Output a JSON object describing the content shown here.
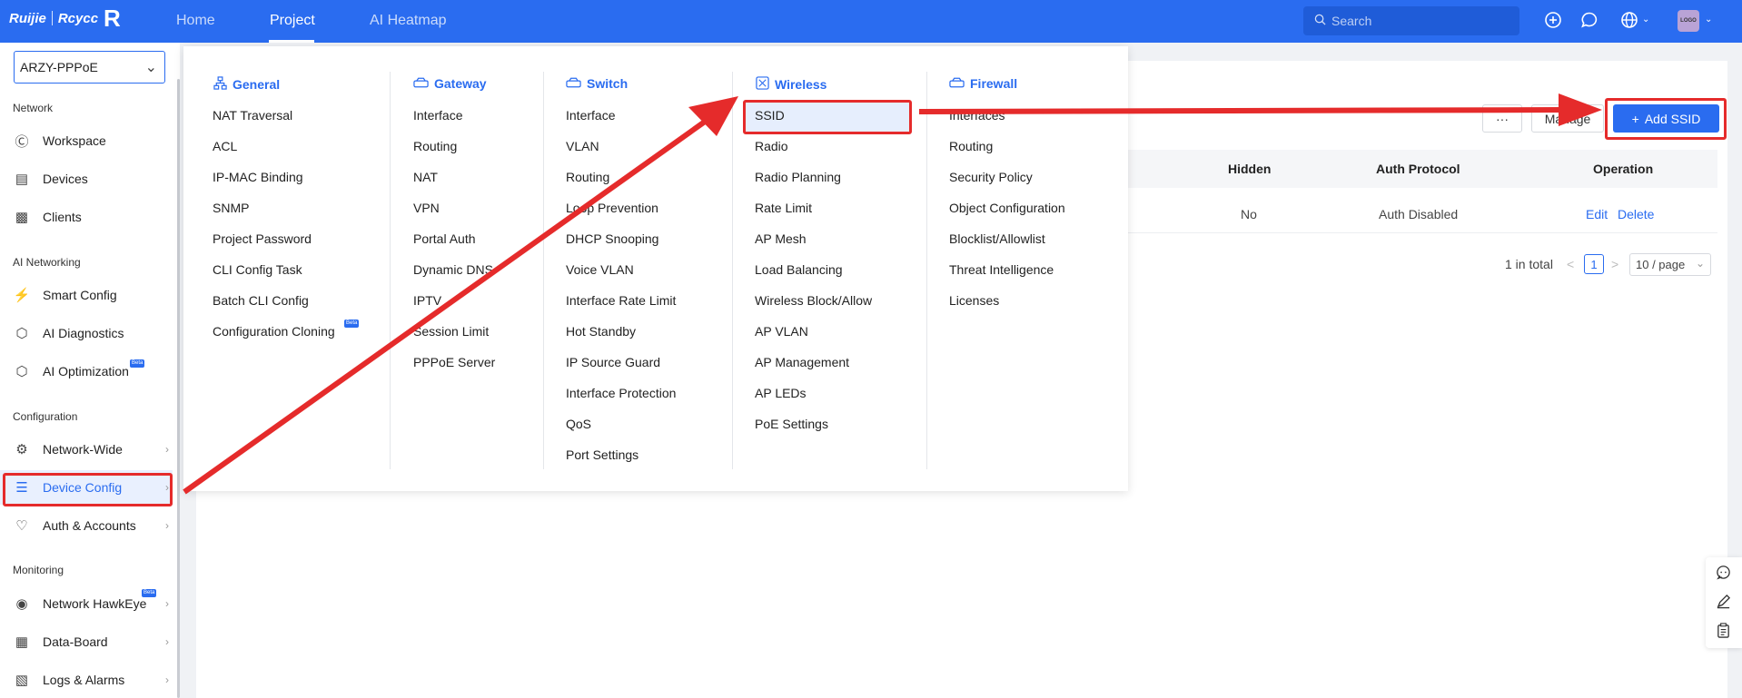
{
  "topbar": {
    "brand": "Ruijie",
    "brand2": "Rcycc",
    "brand_mark": "R",
    "nav": [
      "Home",
      "Project",
      "AI Heatmap"
    ],
    "active_nav": "Project",
    "search_placeholder": "Search",
    "avatar_text": "LOGO",
    "accent": "#2a6cf0"
  },
  "sidebar": {
    "project": "ARZY-PPPoE",
    "sections": {
      "network": "Network",
      "ai": "AI Networking",
      "config": "Configuration",
      "monitoring": "Monitoring"
    },
    "items": {
      "workspace": "Workspace",
      "devices": "Devices",
      "clients": "Clients",
      "smart_config": "Smart Config",
      "ai_diagnostics": "AI Diagnostics",
      "ai_optimization": "AI Optimization",
      "network_wide": "Network-Wide",
      "device_config": "Device Config",
      "auth_accounts": "Auth & Accounts",
      "network_hawkeye": "Network HawkEye",
      "data_board": "Data-Board",
      "logs_alarms": "Logs & Alarms"
    },
    "beta_label": "Beta"
  },
  "dropdown": {
    "general": {
      "title": "General",
      "items": [
        "NAT Traversal",
        "ACL",
        "IP-MAC Binding",
        "SNMP",
        "Project Password",
        "CLI Config Task",
        "Batch CLI Config",
        "Configuration Cloning"
      ]
    },
    "gateway": {
      "title": "Gateway",
      "items": [
        "Interface",
        "Routing",
        "NAT",
        "VPN",
        "Portal Auth",
        "Dynamic DNS",
        "IPTV",
        "Session Limit",
        "PPPoE Server"
      ]
    },
    "switch": {
      "title": "Switch",
      "items": [
        "Interface",
        "VLAN",
        "Routing",
        "Loop Prevention",
        "DHCP Snooping",
        "Voice VLAN",
        "Interface Rate Limit",
        "Hot Standby",
        "IP Source Guard",
        "Interface Protection",
        "QoS",
        "Port Settings"
      ]
    },
    "wireless": {
      "title": "Wireless",
      "items": [
        "SSID",
        "Radio",
        "Radio Planning",
        "Rate Limit",
        "AP Mesh",
        "Load Balancing",
        "Wireless Block/Allow",
        "AP VLAN",
        "AP Management",
        "AP LEDs",
        "PoE Settings"
      ]
    },
    "firewall": {
      "title": "Firewall",
      "items": [
        "Interfaces",
        "Routing",
        "Security Policy",
        "Object Configuration",
        "Blocklist/Allowlist",
        "Threat Intelligence",
        "Licenses"
      ]
    }
  },
  "content": {
    "more_label": "···",
    "manage_label": "Manage",
    "add_ssid_label": "Add SSID",
    "add_icon": "+",
    "table": {
      "headers": [
        "Hidden",
        "Auth Protocol",
        "Operation"
      ],
      "row": {
        "hidden": "No",
        "auth": "Auth Disabled",
        "edit": "Edit",
        "delete": "Delete"
      }
    },
    "pagination": {
      "total": "1 in total",
      "prev": "<",
      "page": "1",
      "next": ">",
      "size": "10 / page"
    }
  },
  "annotation_color": "#e52b2b"
}
